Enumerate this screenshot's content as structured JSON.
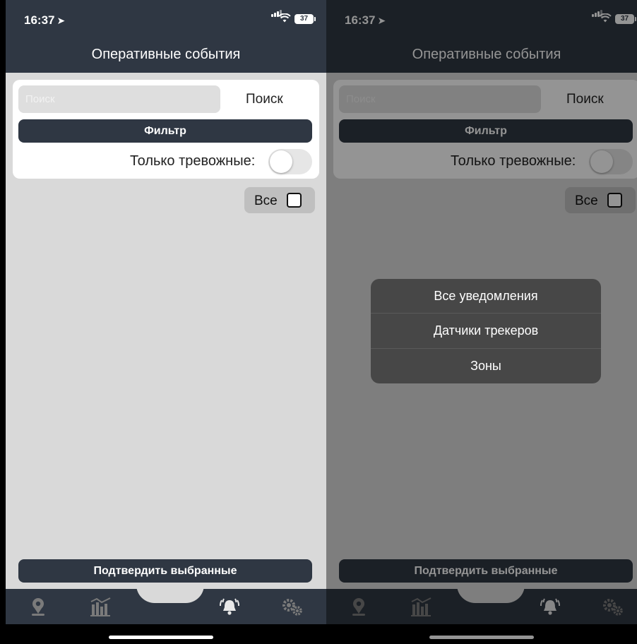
{
  "status_bar": {
    "time": "16:37",
    "battery": "37"
  },
  "header": {
    "title": "Оперативные события"
  },
  "search": {
    "placeholder": "Поиск",
    "value": "",
    "button_label": "Поиск"
  },
  "filter": {
    "button_label": "Фильтр"
  },
  "alarm_toggle": {
    "label": "Только тревожные:",
    "state": "off"
  },
  "select_all": {
    "label": "Все",
    "checked": false
  },
  "confirm": {
    "button_label": "Подтвердить выбранные"
  },
  "tab_bar": {
    "tabs": [
      {
        "icon": "map-pin-icon",
        "selected": false
      },
      {
        "icon": "reports-icon",
        "selected": false
      },
      {
        "icon": "alarm-bell-icon",
        "selected": true
      },
      {
        "icon": "settings-gears-icon",
        "selected": false
      }
    ]
  },
  "filter_menu": {
    "items": [
      "Все уведомления",
      "Датчики трекеров",
      "Зоны"
    ]
  },
  "colors": {
    "header_bg": "#2f3743",
    "page_bg": "#d9d9d9",
    "button_bg": "#2f3743",
    "icon_color": "#7a7a7a"
  }
}
